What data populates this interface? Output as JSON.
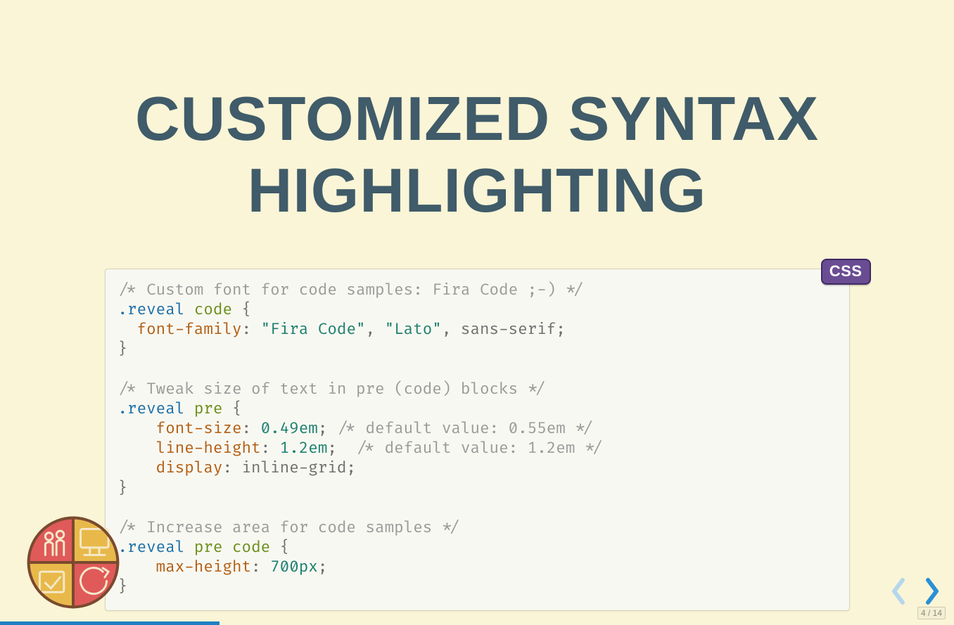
{
  "slide": {
    "title": "CUSTOMIZED SYNTAX HIGHLIGHTING",
    "code_language_badge": "CSS",
    "code_tokens": [
      {
        "cls": "c-comment",
        "t": "/* Custom font for code samples: Fira Code ;-) */"
      },
      {
        "cls": "nl",
        "t": "\n"
      },
      {
        "cls": "c-sel",
        "t": ".reveal"
      },
      {
        "cls": "c-plain",
        "t": " "
      },
      {
        "cls": "c-tag",
        "t": "code"
      },
      {
        "cls": "c-plain",
        "t": " {"
      },
      {
        "cls": "nl",
        "t": "\n"
      },
      {
        "cls": "c-plain",
        "t": "  "
      },
      {
        "cls": "c-prop",
        "t": "font-family"
      },
      {
        "cls": "c-plain",
        "t": ": "
      },
      {
        "cls": "c-str",
        "t": "\"Fira Code\""
      },
      {
        "cls": "c-plain",
        "t": ", "
      },
      {
        "cls": "c-str",
        "t": "\"Lato\""
      },
      {
        "cls": "c-plain",
        "t": ", sans-serif;"
      },
      {
        "cls": "nl",
        "t": "\n"
      },
      {
        "cls": "c-plain",
        "t": "}"
      },
      {
        "cls": "nl",
        "t": "\n"
      },
      {
        "cls": "nl",
        "t": "\n"
      },
      {
        "cls": "c-comment",
        "t": "/* Tweak size of text in pre (code) blocks */"
      },
      {
        "cls": "nl",
        "t": "\n"
      },
      {
        "cls": "c-sel",
        "t": ".reveal"
      },
      {
        "cls": "c-plain",
        "t": " "
      },
      {
        "cls": "c-tag",
        "t": "pre"
      },
      {
        "cls": "c-plain",
        "t": " {"
      },
      {
        "cls": "nl",
        "t": "\n"
      },
      {
        "cls": "c-plain",
        "t": "    "
      },
      {
        "cls": "c-prop",
        "t": "font-size"
      },
      {
        "cls": "c-plain",
        "t": ": "
      },
      {
        "cls": "c-num",
        "t": "0.49em"
      },
      {
        "cls": "c-plain",
        "t": "; "
      },
      {
        "cls": "c-comment",
        "t": "/* default value: 0.55em */"
      },
      {
        "cls": "nl",
        "t": "\n"
      },
      {
        "cls": "c-plain",
        "t": "    "
      },
      {
        "cls": "c-prop",
        "t": "line-height"
      },
      {
        "cls": "c-plain",
        "t": ": "
      },
      {
        "cls": "c-num",
        "t": "1.2em"
      },
      {
        "cls": "c-plain",
        "t": ";  "
      },
      {
        "cls": "c-comment",
        "t": "/* default value: 1.2em */"
      },
      {
        "cls": "nl",
        "t": "\n"
      },
      {
        "cls": "c-plain",
        "t": "    "
      },
      {
        "cls": "c-prop",
        "t": "display"
      },
      {
        "cls": "c-plain",
        "t": ": inline-grid;"
      },
      {
        "cls": "nl",
        "t": "\n"
      },
      {
        "cls": "c-plain",
        "t": "}"
      },
      {
        "cls": "nl",
        "t": "\n"
      },
      {
        "cls": "nl",
        "t": "\n"
      },
      {
        "cls": "c-comment",
        "t": "/* Increase area for code samples */"
      },
      {
        "cls": "nl",
        "t": "\n"
      },
      {
        "cls": "c-sel",
        "t": ".reveal"
      },
      {
        "cls": "c-plain",
        "t": " "
      },
      {
        "cls": "c-tag",
        "t": "pre"
      },
      {
        "cls": "c-plain",
        "t": " "
      },
      {
        "cls": "c-tag",
        "t": "code"
      },
      {
        "cls": "c-plain",
        "t": " {"
      },
      {
        "cls": "nl",
        "t": "\n"
      },
      {
        "cls": "c-plain",
        "t": "    "
      },
      {
        "cls": "c-prop",
        "t": "max-height"
      },
      {
        "cls": "c-plain",
        "t": ": "
      },
      {
        "cls": "c-num",
        "t": "700px"
      },
      {
        "cls": "c-plain",
        "t": ";"
      },
      {
        "cls": "nl",
        "t": "\n"
      },
      {
        "cls": "c-plain",
        "t": "}"
      }
    ]
  },
  "pagination": {
    "current": 4,
    "total": 14,
    "label": "4 / 14"
  },
  "progress_percent": 23,
  "colors": {
    "bg": "#faf5d6",
    "heading": "#405b69",
    "badge_bg": "#6a4c93",
    "accent_blue": "#1e7fc4"
  }
}
